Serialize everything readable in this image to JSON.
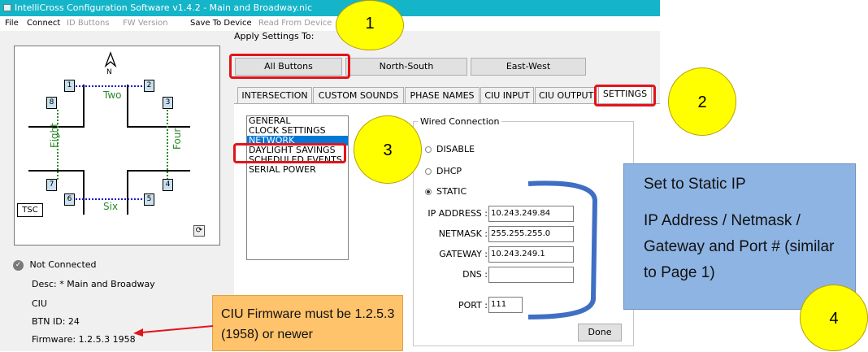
{
  "window": {
    "title": "IntelliCross Configuration Software v1.4.2 - Main and Broadway.nic",
    "menu": [
      "File",
      "Connect",
      "ID Buttons",
      "FW Version",
      "Save To Device",
      "Read From Device"
    ]
  },
  "intersection": {
    "compass": "N",
    "buttons": [
      "1",
      "2",
      "3",
      "4",
      "5",
      "6",
      "7",
      "8"
    ],
    "phases": {
      "top": "Two",
      "right": "Four",
      "bottom": "Six",
      "left": "Eight"
    },
    "tsc_label": "TSC"
  },
  "apply_settings": {
    "label": "Apply Settings To:",
    "options": [
      "All Buttons",
      "North-South",
      "East-West"
    ]
  },
  "tabs": [
    "INTERSECTION",
    "CUSTOM SOUNDS",
    "PHASE NAMES",
    "CIU INPUT",
    "CIU OUTPUT",
    "SETTINGS"
  ],
  "settings_list": [
    "GENERAL",
    "CLOCK SETTINGS",
    "NETWORK",
    "DAYLIGHT SAVINGS",
    "SCHEDULED EVENTS",
    "SERIAL POWER"
  ],
  "wired": {
    "title": "Wired Connection",
    "modes": [
      "DISABLE",
      "DHCP",
      "STATIC"
    ],
    "selected_mode": "STATIC",
    "fields": {
      "ip_label": "IP ADDRESS :",
      "ip_value": "10.243.249.84",
      "netmask_label": "NETMASK :",
      "netmask_value": "255.255.255.0",
      "gateway_label": "GATEWAY :",
      "gateway_value": "10.243.249.1",
      "dns_label": "DNS :",
      "dns_value": "",
      "port_label": "PORT :",
      "port_value": "111"
    },
    "done": "Done"
  },
  "status": {
    "connection": "Not Connected",
    "desc": "Desc: * Main and Broadway",
    "type": "CIU",
    "btn_id": "BTN ID: 24",
    "firmware": "Firmware: 1.2.5.3 1958"
  },
  "annotations": {
    "steps": [
      "1",
      "2",
      "3",
      "4"
    ],
    "static_note_title": "Set to Static IP",
    "static_note_body": "IP Address / Netmask / Gateway and Port # (similar to Page 1)",
    "firmware_note": "CIU Firmware must be 1.2.5.3 (1958) or newer"
  },
  "colors": {
    "title_bar": "#14b5c9",
    "highlight": "#e2141b",
    "callout_yellow": "#ffff00",
    "note_blue": "#8eb4e3",
    "note_orange": "#ffc36b"
  }
}
